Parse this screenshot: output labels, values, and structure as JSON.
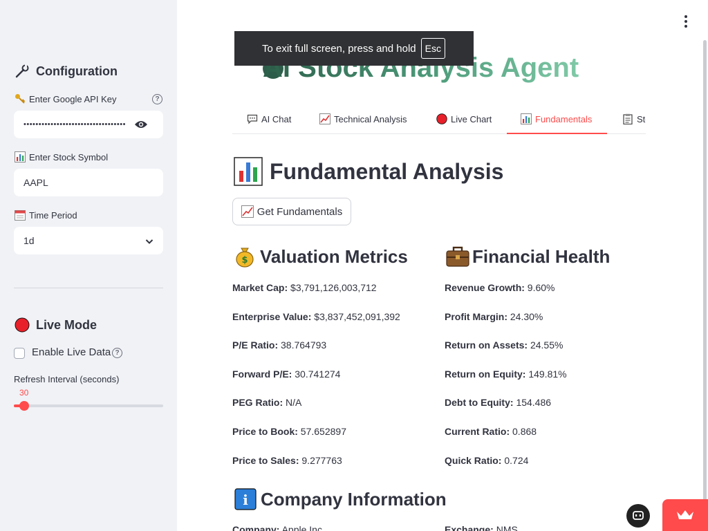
{
  "sidebar": {
    "config_heading": "Configuration",
    "api_key_label": "Enter Google API Key",
    "api_key_value": "••••••••••••••••••••••••••••••••••••••",
    "symbol_label": "Enter Stock Symbol",
    "symbol_value": "AAPL",
    "period_label": "Time Period",
    "period_value": "1d",
    "live_heading": "Live Mode",
    "live_checkbox_label": "Enable Live Data",
    "live_checkbox_checked": false,
    "refresh_label": "Refresh Interval (seconds)",
    "refresh_value": "30",
    "refresh_fraction": 0.0
  },
  "toast": {
    "text": "To exit full screen, press and hold",
    "key": "Esc"
  },
  "header": {
    "app_title": "AI Stock Analysis Agent"
  },
  "tabs": [
    {
      "label": "AI Chat",
      "icon": "speech-bubble-icon",
      "active": false
    },
    {
      "label": "Technical Analysis",
      "icon": "chart-increasing-icon",
      "active": false
    },
    {
      "label": "Live Chart",
      "icon": "red-circle-icon",
      "active": false
    },
    {
      "label": "Fundamentals",
      "icon": "bar-chart-icon",
      "active": true
    },
    {
      "label": "Sto",
      "icon": "clipboard-icon",
      "active": false
    }
  ],
  "main": {
    "page_title": "Fundamental Analysis",
    "get_button": "Get Fundamentals",
    "valuation_heading": "Valuation Metrics",
    "health_heading": "Financial Health",
    "company_heading": "Company Information",
    "valuation": [
      {
        "label": "Market Cap:",
        "value": "$3,791,126,003,712"
      },
      {
        "label": "Enterprise Value:",
        "value": "$3,837,452,091,392"
      },
      {
        "label": "P/E Ratio:",
        "value": "38.764793"
      },
      {
        "label": "Forward P/E:",
        "value": "30.741274"
      },
      {
        "label": "PEG Ratio:",
        "value": "N/A"
      },
      {
        "label": "Price to Book:",
        "value": "57.652897"
      },
      {
        "label": "Price to Sales:",
        "value": "9.277763"
      }
    ],
    "health": [
      {
        "label": "Revenue Growth:",
        "value": "9.60%"
      },
      {
        "label": "Profit Margin:",
        "value": "24.30%"
      },
      {
        "label": "Return on Assets:",
        "value": "24.55%"
      },
      {
        "label": "Return on Equity:",
        "value": "149.81%"
      },
      {
        "label": "Debt to Equity:",
        "value": "154.486"
      },
      {
        "label": "Current Ratio:",
        "value": "0.868"
      },
      {
        "label": "Quick Ratio:",
        "value": "0.724"
      }
    ],
    "company": [
      {
        "label": "Company:",
        "value": "Apple Inc."
      },
      {
        "label": "Exchange:",
        "value": "NMS"
      }
    ]
  },
  "colors": {
    "accent": "#ff4b4b",
    "sidebar_bg": "#f0f2f6",
    "text": "#31333f",
    "title_gradient_start": "#2c5f4a",
    "title_gradient_end": "#80c9a7"
  }
}
